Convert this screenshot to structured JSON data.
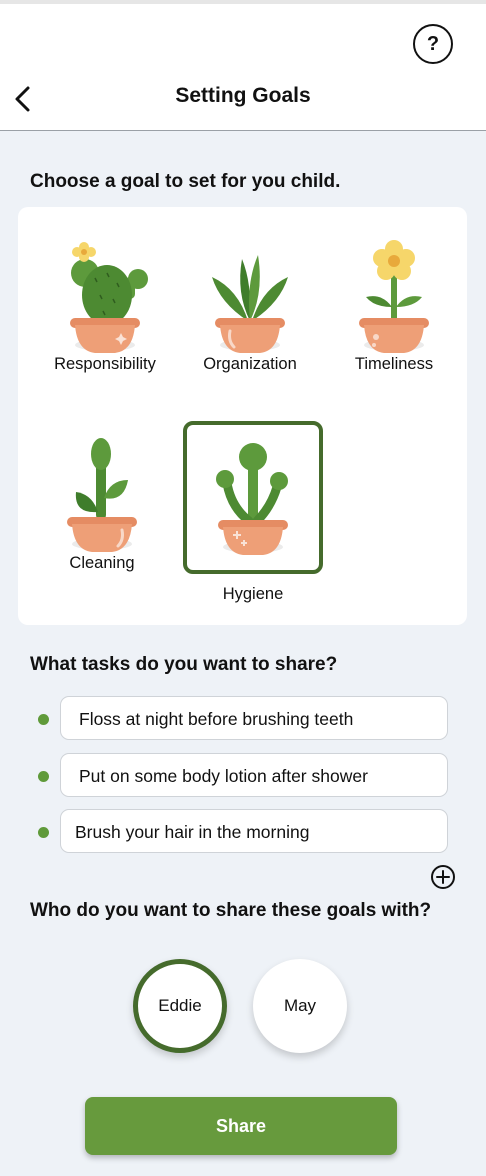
{
  "header": {
    "title": "Setting Goals",
    "help_label": "?"
  },
  "goals_section": {
    "title": "Choose a goal to set for you child.",
    "goals": [
      {
        "label": "Responsibility",
        "icon": "cactus-plant-icon",
        "selected": false
      },
      {
        "label": "Organization",
        "icon": "snake-plant-icon",
        "selected": false
      },
      {
        "label": "Timeliness",
        "icon": "flower-plant-icon",
        "selected": false
      },
      {
        "label": "Cleaning",
        "icon": "sprout-plant-icon",
        "selected": false
      },
      {
        "label": "Hygiene",
        "icon": "bubble-plant-icon",
        "selected": true
      }
    ]
  },
  "tasks_section": {
    "title": "What tasks do you want to share?",
    "tasks": [
      "Floss at night before brushing teeth",
      "Put on some body lotion after shower",
      "Brush your hair in the morning"
    ]
  },
  "share_section": {
    "title": "Who do you want to share these goals with?",
    "people": [
      {
        "name": "Eddie",
        "selected": true
      },
      {
        "name": "May",
        "selected": false
      }
    ]
  },
  "share_button": "Share",
  "colors": {
    "accent_green": "#679a3d",
    "selected_border": "#456b2c",
    "pot": "#e89a75",
    "background": "#eef2f7"
  }
}
